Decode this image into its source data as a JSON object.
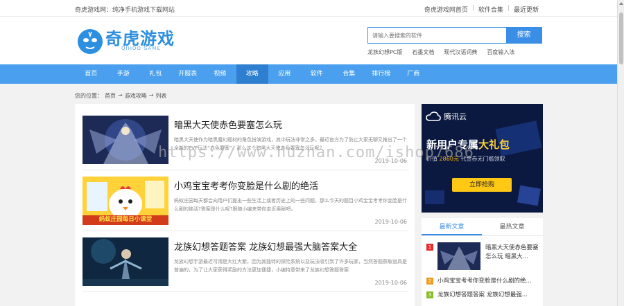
{
  "topbar": {
    "tagline": "奇虎游戏网：纯净手机游戏下载网站",
    "links": [
      "奇虎游戏网首页",
      "软件合集",
      "最近更新"
    ]
  },
  "logo": {
    "name": "奇虎游戏",
    "sub": "QIHOO GAME",
    "color": "#2d8fe0"
  },
  "search": {
    "placeholder": "请输入要搜索的软件",
    "button": "搜索",
    "hotwords": [
      "龙族幻想PC版",
      "石墨文档",
      "现代汉语词典",
      "百度输入法"
    ]
  },
  "nav": {
    "items": [
      "首页",
      "手游",
      "礼包",
      "开服表",
      "视频",
      "攻略",
      "应用",
      "软件",
      "合集",
      "排行榜",
      "厂商"
    ],
    "active_index": 5,
    "color": "#4aa0ee",
    "active_color": "#2f7fd0"
  },
  "breadcrumb": {
    "label": "您的位置：",
    "items": [
      "首页",
      "游戏攻略",
      "列表"
    ],
    "separator": "→"
  },
  "articles": [
    {
      "title": "暗黑大天使赤色要塞怎么玩",
      "desc": "暗黑大天使作为暗黑魔幻题材的角色扮演游戏，其中玩法非常之多，最近官方为了防止大家无聊又推出了一个全新的PVP玩法“赤色要塞”，那么这个暗黑大天使赤色要塞怎么玩呢？",
      "date": "2019-10-06",
      "thumb_icon": "dark-angel-warrior-image"
    },
    {
      "title": "小鸡宝宝考考你变脸是什么剧的绝活",
      "desc": "蚂蚁庄园每天都会向用户们提出一些生活上或者历史上的一些问题，那么今天的题目小鸡宝宝考考你变脸是什么剧的绝活?答案是什么呢?跟随小编来带你走近奥秘吧。",
      "date": "2019-10-06",
      "thumb_icon": "chick-cartoon-image",
      "thumb_caption": "蚂蚁庄园每日小课堂"
    },
    {
      "title": "龙族幻想答题答案 龙族幻想最强大脑答案大全",
      "desc": "龙族幻想手游最近可谓是大红大紫，因为其独特的探险系统以及玩法吸引到了许多玩家，当然答题获取道具是普遍的，为了让大家获得奖励的方法更加便捷，小编特意带来了龙族幻想答题答案",
      "date": "2019-10-06",
      "thumb_icon": "dragon-raja-character-image"
    }
  ],
  "ad": {
    "brand": "腾讯云",
    "headline_a": "新用户专属",
    "headline_b": "大礼包",
    "sub_a": "价值",
    "sub_b": "2860元",
    "sub_c": "代金券无门槛领取",
    "cta": "立即抢购",
    "bg_color": "#0b1940",
    "accent": "#ffd33d"
  },
  "sidebar": {
    "tabs": [
      "最新文章",
      "最热文章"
    ],
    "active_tab": 0,
    "items": [
      {
        "num": "1",
        "title": "暗黑大天使赤色要塞怎么玩 暗黑大..."
      },
      {
        "num": "2",
        "title": "小鸡宝宝考考你变脸是什么剧的绝..."
      },
      {
        "num": "3",
        "title": "龙族幻想答题答案 龙族幻想最强..."
      }
    ]
  },
  "watermark": "https://www.huzhan.com/ishop7686"
}
